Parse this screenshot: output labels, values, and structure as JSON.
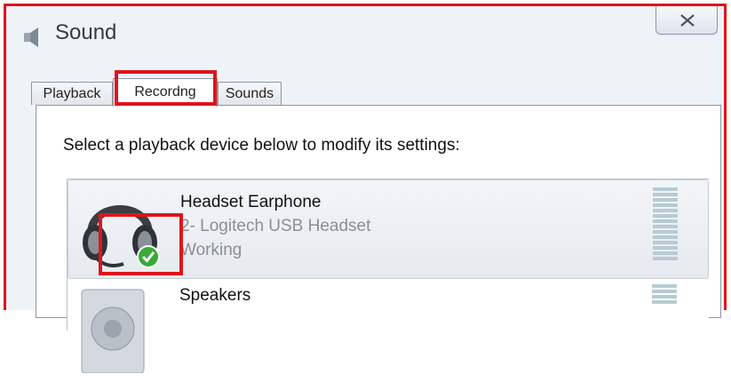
{
  "window": {
    "title": "Sound"
  },
  "icons": {
    "title_icon": "speaker-icon",
    "close": "close-icon",
    "status_badge": "green-check-icon"
  },
  "tabs": [
    {
      "label": "Playback",
      "active": false
    },
    {
      "label": "Recordng",
      "active": true
    },
    {
      "label": "Sounds",
      "active": false
    }
  ],
  "panel": {
    "instruction": "Select a playback device below to modify its settings:"
  },
  "devices": [
    {
      "name": "Headset Earphone",
      "description": "2- Logitech USB Headset",
      "status": "Working",
      "icon": "headset-icon",
      "default": true
    },
    {
      "name": "Speakers",
      "icon": "speaker-device-icon"
    }
  ],
  "colors": {
    "highlight_border": "#e0141c",
    "check_green": "#3aa935",
    "meter": "#b7cbd4"
  }
}
